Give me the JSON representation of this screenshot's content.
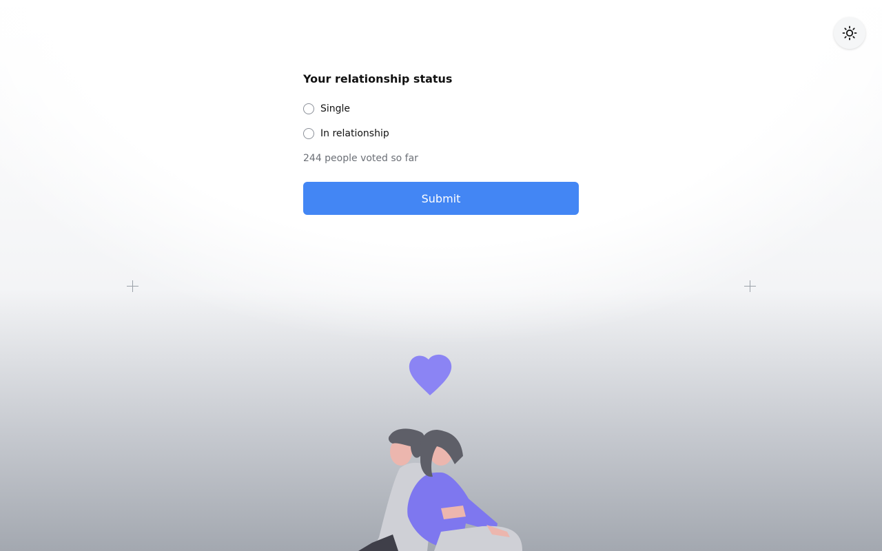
{
  "header": {
    "theme_toggle_icon": "sun-icon"
  },
  "poll": {
    "title": "Your relationship status",
    "options": [
      {
        "label": "Single",
        "selected": false
      },
      {
        "label": "In relationship",
        "selected": false
      }
    ],
    "vote_count_text": "244 people voted so far",
    "submit_label": "Submit"
  },
  "colors": {
    "accent": "#4386f4",
    "heart": "#8b84f4",
    "shirt": "#7e77ef"
  },
  "illustration": {
    "icon": "couple-heart-illustration"
  }
}
